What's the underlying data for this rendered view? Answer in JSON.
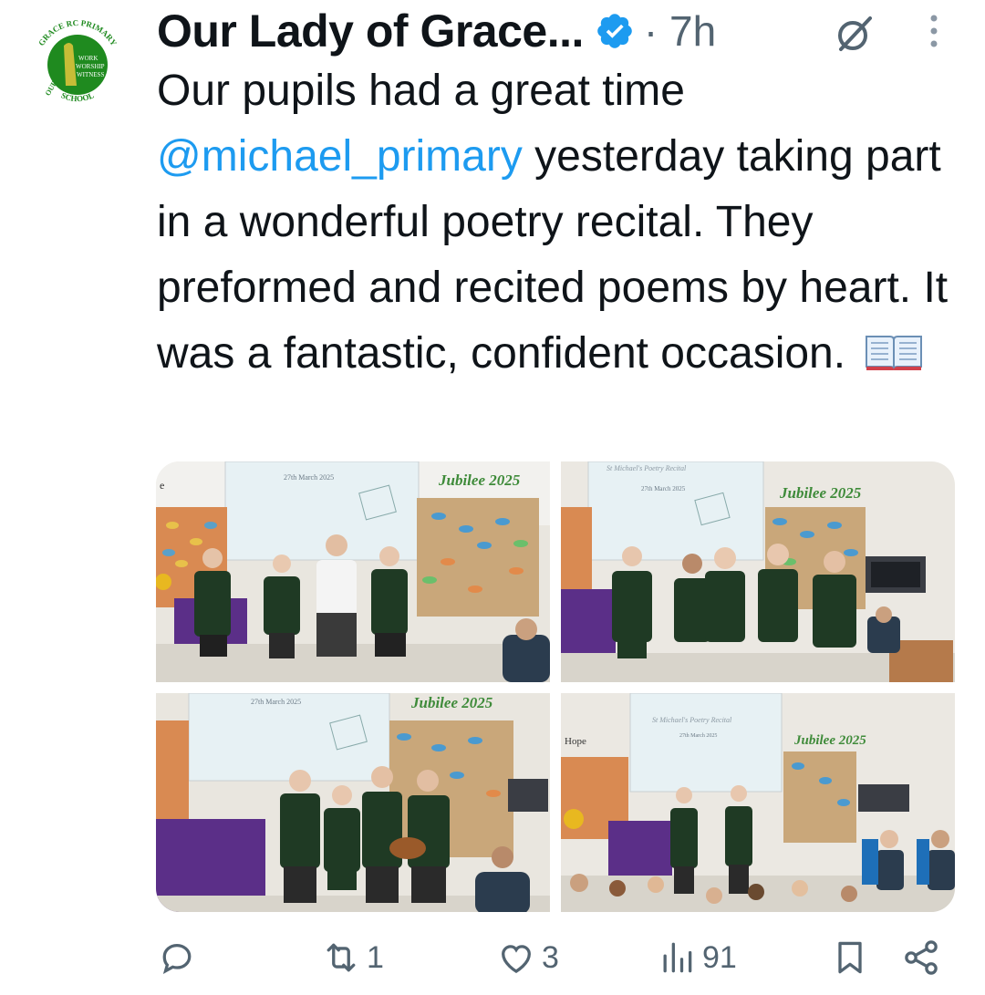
{
  "tweet": {
    "author_name": "Our Lady of Grace...",
    "separator": "·",
    "time_ago": "7h",
    "text_before_mention": "Our pupils had a great time ",
    "mention": "@michael_primary",
    "text_after_mention": " yesterday taking part in a wonderful poetry recital. They preformed and recited poems by heart. It was a fantastic, confident occasion.",
    "emoji_icon": "open-book-emoji"
  },
  "avatar": {
    "logo_top_text": "GRACE RC PRIMARY",
    "logo_left_text": "OUR LADY OF",
    "logo_bottom_text": "SCHOOL",
    "motto": [
      "WORK",
      "WORSHIP",
      "WITNESS"
    ],
    "color": "#1f8a1f"
  },
  "media": {
    "photos": [
      {
        "slide_title": "",
        "slide_date": "27th March 2025",
        "banner": "Jubilee 2025",
        "wall_text": "e"
      },
      {
        "slide_title": "St Michael's Poetry Recital",
        "slide_date": "27th March 2025",
        "banner": "Jubilee 2025"
      },
      {
        "slide_title": "",
        "slide_date": "27th March 2025",
        "banner": "Jubilee 2025"
      },
      {
        "slide_title": "St Michael's Poetry Recital",
        "slide_date": "27th March 2025",
        "banner": "Jubilee 2025",
        "wall_text": "Hope"
      }
    ]
  },
  "actions": {
    "reply_count": "",
    "retweet_count": "1",
    "like_count": "3",
    "views_count": "91"
  },
  "colors": {
    "accent": "#1d9bf0",
    "muted": "#536471",
    "text": "#0f1419"
  }
}
